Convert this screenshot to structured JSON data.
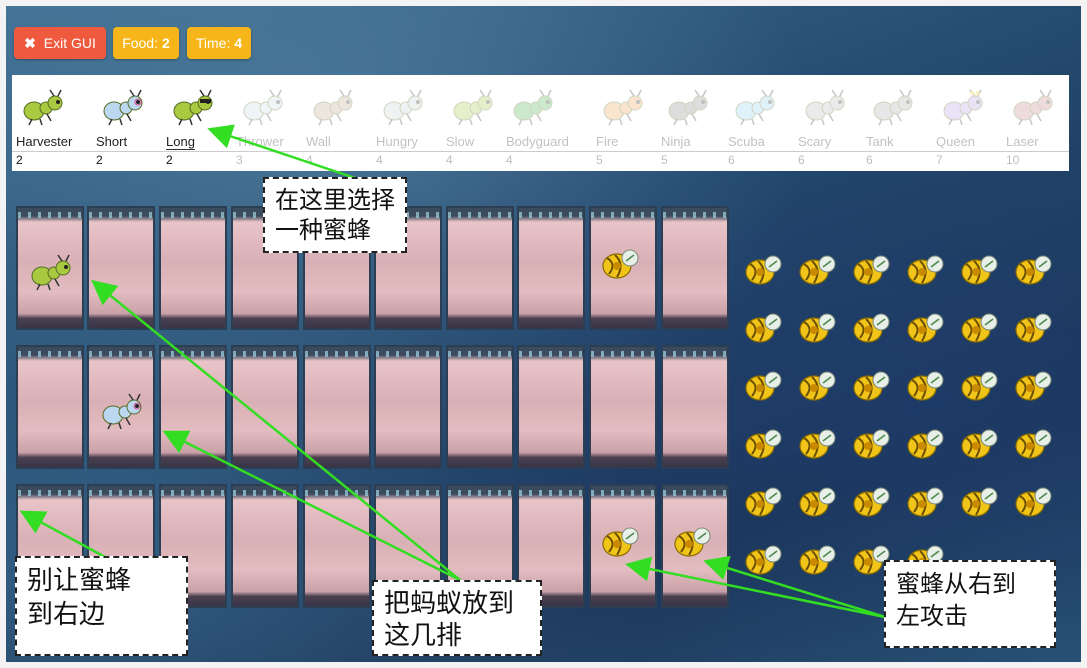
{
  "header": {
    "exit_label": "Exit GUI",
    "food_label": "Food:",
    "food_value": "2",
    "time_label": "Time:",
    "time_value": "4"
  },
  "bees": [
    {
      "name": "Harvester",
      "cost": "2",
      "icon": "harvester-ant-icon",
      "available": true
    },
    {
      "name": "Short",
      "cost": "2",
      "icon": "short-thrower-ant-icon",
      "available": true
    },
    {
      "name": "Long",
      "cost": "2",
      "icon": "long-thrower-ant-icon",
      "available": true,
      "selected": true
    },
    {
      "name": "Thrower",
      "cost": "3",
      "icon": "thrower-ant-icon",
      "available": false
    },
    {
      "name": "Wall",
      "cost": "4",
      "icon": "wall-ant-icon",
      "available": false
    },
    {
      "name": "Hungry",
      "cost": "4",
      "icon": "hungry-ant-icon",
      "available": false
    },
    {
      "name": "Slow",
      "cost": "4",
      "icon": "slow-thrower-ant-icon",
      "available": false
    },
    {
      "name": "Bodyguard",
      "cost": "4",
      "icon": "bodyguard-ant-icon",
      "available": false
    },
    {
      "name": "Fire",
      "cost": "5",
      "icon": "fire-ant-icon",
      "available": false
    },
    {
      "name": "Ninja",
      "cost": "5",
      "icon": "ninja-ant-icon",
      "available": false
    },
    {
      "name": "Scuba",
      "cost": "6",
      "icon": "scuba-ant-icon",
      "available": false
    },
    {
      "name": "Scary",
      "cost": "6",
      "icon": "scary-ant-icon",
      "available": false
    },
    {
      "name": "Tank",
      "cost": "6",
      "icon": "tank-ant-icon",
      "available": false
    },
    {
      "name": "Queen",
      "cost": "7",
      "icon": "queen-ant-icon",
      "available": false
    },
    {
      "name": "Laser",
      "cost": "10",
      "icon": "laser-ant-icon",
      "available": false
    }
  ],
  "callouts": {
    "select": "在这里选择\n一种蜜蜂",
    "dont_let": "别让蜜蜂\n到右边",
    "place": "把蚂蚁放到\n这几排",
    "attack": "蜜蜂从右到\n左攻击"
  },
  "colors": {
    "exit_button": "#ef5a3f",
    "badge": "#f6b61a",
    "arrow": "#33dd22"
  },
  "board": {
    "rows": 3,
    "cols": 10,
    "placed_ants": [
      {
        "row": 0,
        "col": 0,
        "type": "harvester-ant-icon"
      },
      {
        "row": 1,
        "col": 1,
        "type": "short-thrower-ant-icon"
      }
    ],
    "bees_on_board": [
      {
        "row": 0,
        "col": 8
      },
      {
        "row": 2,
        "col": 8
      },
      {
        "row": 2,
        "col": 9
      }
    ]
  },
  "hive": {
    "bee_rows": [
      6,
      6,
      6,
      6,
      6,
      4
    ]
  }
}
